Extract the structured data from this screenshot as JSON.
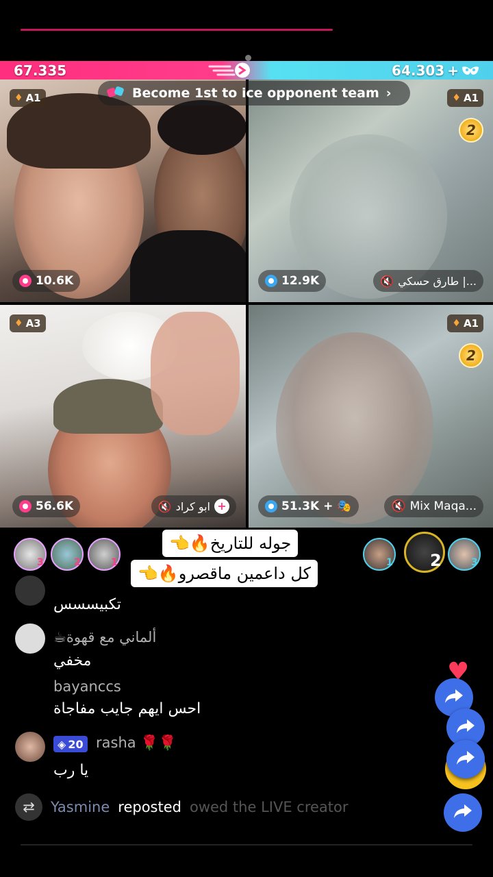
{
  "battle": {
    "score_left": "67.335",
    "score_right": "64.303",
    "banner_text": "Become 1st to ice opponent team",
    "colors": {
      "left": "#ff2e7e",
      "right": "#4fd0ec"
    }
  },
  "cells": [
    {
      "badge": "A1",
      "coins": "10.6K",
      "name": ""
    },
    {
      "badge": "A1",
      "rank": "2",
      "coins": "12.9K",
      "name": "طارق حسكي |..."
    },
    {
      "badge": "A3",
      "coins": "56.6K",
      "name": "ابو كراد"
    },
    {
      "badge": "A1",
      "rank": "2",
      "coins": "51.3K",
      "name": "Mix  Maqa..."
    }
  ],
  "supporters_left": [
    "3",
    "2",
    "1"
  ],
  "supporters_right": [
    "1",
    "2",
    "3"
  ],
  "pinned": {
    "line1": "جوله للتاريخ🔥👈",
    "line2": "كل داعمين ماقصرو🔥👈"
  },
  "comments": [
    {
      "name": "",
      "text": "تكبيسسس"
    },
    {
      "name": "☕ألماني مع قهوة",
      "text": "مخفي"
    },
    {
      "name": "bayanccs",
      "text": "احس ايهم جايب مفاجاة"
    },
    {
      "name": "rasha 🌹🌹",
      "level": "20",
      "text": "يا رب"
    }
  ],
  "repost": {
    "user": "Yasmine",
    "action": "reposted",
    "faded": "owed the LIVE creator"
  },
  "icons": [
    "gem-icon",
    "coin-icon",
    "mute-icon",
    "plus-icon",
    "mask-icon",
    "arrow-icon",
    "share-icon",
    "heart-icon",
    "repost-icon"
  ]
}
